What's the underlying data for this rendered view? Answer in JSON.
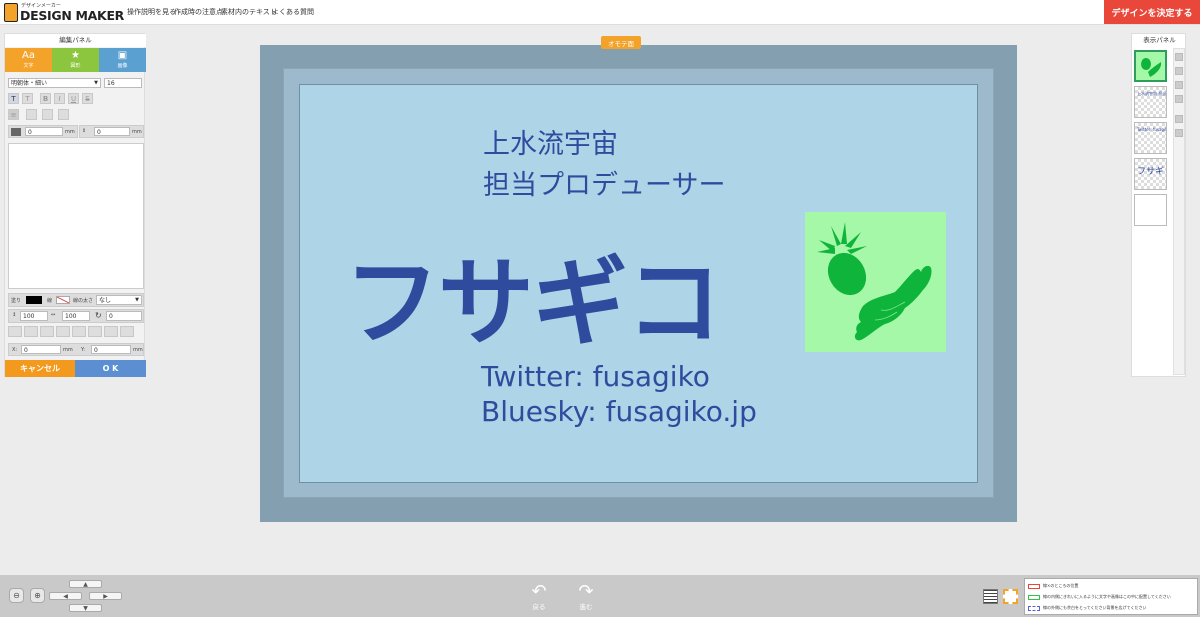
{
  "header": {
    "logo_small": "デザインメーカー",
    "logo_main": "DESIGN MAKER",
    "nav": [
      "操作説明を見る",
      "作成時の注意点",
      "素材内のテキスト",
      "よくある質問"
    ],
    "decide_button": "デザインを決定する",
    "decide_color": "#e9473a"
  },
  "left_panel": {
    "title": "編集パネル",
    "tabs": [
      {
        "label": "文字",
        "icon": "text-icon"
      },
      {
        "label": "図形",
        "icon": "star-icon"
      },
      {
        "label": "画像",
        "icon": "image-icon"
      }
    ],
    "font_select": "明朝体・細い",
    "font_size": "16",
    "style_buttons": [
      "T",
      "T",
      "B",
      "I",
      "U",
      "S"
    ],
    "x_offset": "0",
    "y_offset": "0",
    "unit": "mm",
    "fill_label": "塗り",
    "line_label": "線",
    "line_width_label": "線の太さ",
    "line_width_value": "なし",
    "height_value": "100",
    "width_value": "100",
    "rotate_value": "0",
    "x_label": "X:",
    "x_value": "0",
    "y_label": "Y:",
    "y_value": "0",
    "cancel_button": "キャンセル",
    "ok_button": "O K"
  },
  "canvas": {
    "side_label": "オモテ面",
    "line1": "上水流宇宙",
    "line2": "担当プロデューサー",
    "name": "フサギコ",
    "twitter": "Twitter: fusagiko",
    "bluesky": "Bluesky: fusagiko.jp",
    "colors": {
      "card_bg": "#add5e7",
      "text": "#2f4b9d",
      "image_bg": "#a5f8a8",
      "fruit": "#0fb43b"
    }
  },
  "right_panel": {
    "title": "表示パネル",
    "layers": [
      {
        "type": "image"
      },
      {
        "text": "上水流宇宙 担当プロデューサー"
      },
      {
        "text": "Twitter: fusagiko Bluesky: fusagiko"
      },
      {
        "text": "フサギ"
      },
      {
        "type": "empty"
      }
    ]
  },
  "bottom": {
    "undo_label": "戻る",
    "redo_label": "進む",
    "legend": [
      {
        "text": "線×のところの位置",
        "color": "#e9473a"
      },
      {
        "text": "線の内側にきれいに入るように文字や画像はこの中に配置してください",
        "color": "#38c14a"
      },
      {
        "text": "線の外側にも余白をとってください背景を広げてください",
        "color": "#5b63d1"
      }
    ]
  }
}
